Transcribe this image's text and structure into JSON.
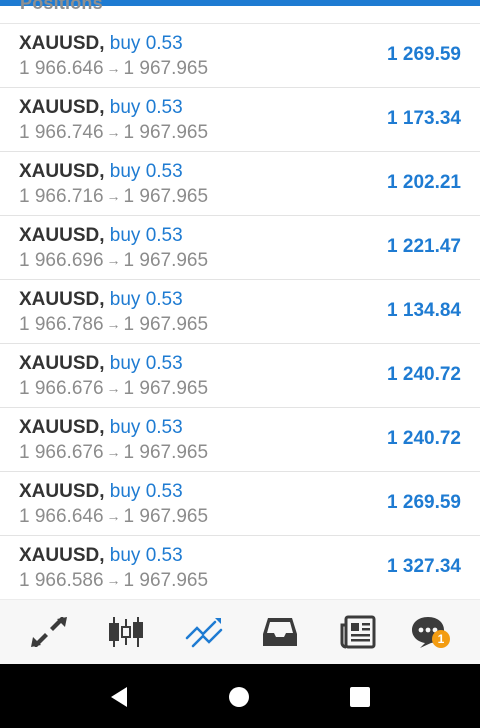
{
  "header": {
    "section_title": "Positions"
  },
  "positions": [
    {
      "symbol": "XAUUSD",
      "side": "buy 0.53",
      "open_price": "1 966.646",
      "current_price": "1 967.965",
      "profit": "1 269.59"
    },
    {
      "symbol": "XAUUSD",
      "side": "buy 0.53",
      "open_price": "1 966.746",
      "current_price": "1 967.965",
      "profit": "1 173.34"
    },
    {
      "symbol": "XAUUSD",
      "side": "buy 0.53",
      "open_price": "1 966.716",
      "current_price": "1 967.965",
      "profit": "1 202.21"
    },
    {
      "symbol": "XAUUSD",
      "side": "buy 0.53",
      "open_price": "1 966.696",
      "current_price": "1 967.965",
      "profit": "1 221.47"
    },
    {
      "symbol": "XAUUSD",
      "side": "buy 0.53",
      "open_price": "1 966.786",
      "current_price": "1 967.965",
      "profit": "1 134.84"
    },
    {
      "symbol": "XAUUSD",
      "side": "buy 0.53",
      "open_price": "1 966.676",
      "current_price": "1 967.965",
      "profit": "1 240.72"
    },
    {
      "symbol": "XAUUSD",
      "side": "buy 0.53",
      "open_price": "1 966.676",
      "current_price": "1 967.965",
      "profit": "1 240.72"
    },
    {
      "symbol": "XAUUSD",
      "side": "buy 0.53",
      "open_price": "1 966.646",
      "current_price": "1 967.965",
      "profit": "1 269.59"
    },
    {
      "symbol": "XAUUSD",
      "side": "buy 0.53",
      "open_price": "1 966.586",
      "current_price": "1 967.965",
      "profit": "1 327.34"
    }
  ],
  "arrow_glyph": "→",
  "tabbar": {
    "tabs": [
      {
        "icon": "quotes-arrows-icon",
        "active": false
      },
      {
        "icon": "candlestick-chart-icon",
        "active": false
      },
      {
        "icon": "trade-chart-icon",
        "active": true
      },
      {
        "icon": "history-inbox-icon",
        "active": false
      },
      {
        "icon": "news-icon",
        "active": false
      },
      {
        "icon": "messages-chat-icon",
        "active": false,
        "badge": "1"
      }
    ]
  },
  "colors": {
    "accent": "#1e7bd2",
    "symbol_text": "#333333",
    "secondary_text": "#8c8c8c",
    "tab_icon": "#3b3b3b",
    "badge": "#f39c12",
    "nav_bar": "#000000"
  },
  "system_nav": {
    "buttons": [
      "back-icon",
      "home-icon",
      "recents-icon"
    ]
  }
}
